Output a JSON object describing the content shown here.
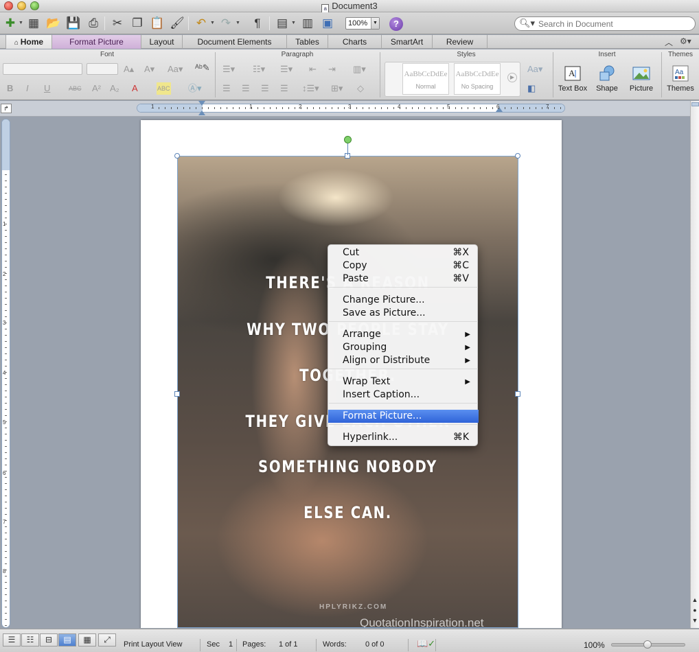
{
  "window": {
    "title": "Document3"
  },
  "toolbar": {
    "zoom_value": "100%",
    "search_placeholder": "Search in Document",
    "pilcrow": "¶",
    "help": "?"
  },
  "tabs": {
    "home": "Home",
    "format_picture": "Format Picture",
    "layout": "Layout",
    "document_elements": "Document Elements",
    "tables": "Tables",
    "charts": "Charts",
    "smartart": "SmartArt",
    "review": "Review"
  },
  "ribbon": {
    "groups": {
      "font": "Font",
      "paragraph": "Paragraph",
      "styles": "Styles",
      "insert": "Insert",
      "themes": "Themes"
    },
    "font_buttons": {
      "bold": "B",
      "italic": "I",
      "underline": "U",
      "strike": "ABC",
      "superscript": "A²",
      "subscript": "A₂",
      "color": "A",
      "highlight": "ABC"
    },
    "styles": [
      {
        "sample": "AaBbCcDdEe",
        "name": "Normal"
      },
      {
        "sample": "AaBbCcDdEe",
        "name": "No Spacing"
      }
    ],
    "insert": {
      "text_box": "Text Box",
      "shape": "Shape",
      "picture": "Picture"
    },
    "themes_label": "Themes"
  },
  "ruler": {
    "numbers": [
      "1",
      "1",
      "2",
      "3",
      "4",
      "5",
      "6",
      "7"
    ]
  },
  "vruler": {
    "numbers": [
      "1",
      "2",
      "3",
      "4",
      "5",
      "6",
      "7",
      "8"
    ]
  },
  "picture": {
    "quote_lines": [
      "THERE'S A REASON",
      "WHY TWO PEOPLE STAY",
      "TOGETHER.",
      "THEY GIVE EACH OTHER",
      "SOMETHING NOBODY",
      "ELSE CAN."
    ],
    "watermark_small": "HPLYRIKZ.COM",
    "watermark_large": "QuotationInspiration.net"
  },
  "context_menu": {
    "items": [
      {
        "label": "Cut",
        "shortcut": "⌘X"
      },
      {
        "label": "Copy",
        "shortcut": "⌘C"
      },
      {
        "label": "Paste",
        "shortcut": "⌘V"
      },
      {
        "label": "Change Picture...",
        "shortcut": ""
      },
      {
        "label": "Save as Picture...",
        "shortcut": ""
      },
      {
        "label": "Arrange",
        "submenu": "▶"
      },
      {
        "label": "Grouping",
        "submenu": "▶"
      },
      {
        "label": "Align or Distribute",
        "submenu": "▶"
      },
      {
        "label": "Wrap Text",
        "submenu": "▶"
      },
      {
        "label": "Insert Caption...",
        "shortcut": ""
      },
      {
        "label": "Format Picture...",
        "shortcut": "",
        "highlighted": true
      },
      {
        "label": "Hyperlink...",
        "shortcut": "⌘K"
      }
    ]
  },
  "statusbar": {
    "view": "Print Layout View",
    "sec_label": "Sec",
    "sec_value": "1",
    "pages_label": "Pages:",
    "pages_value": "1 of 1",
    "words_label": "Words:",
    "words_value": "0 of 0",
    "zoom": "100%"
  },
  "colors": {
    "highlight": "#2f63d8",
    "format_picture_tab": "#cfb0d8"
  }
}
